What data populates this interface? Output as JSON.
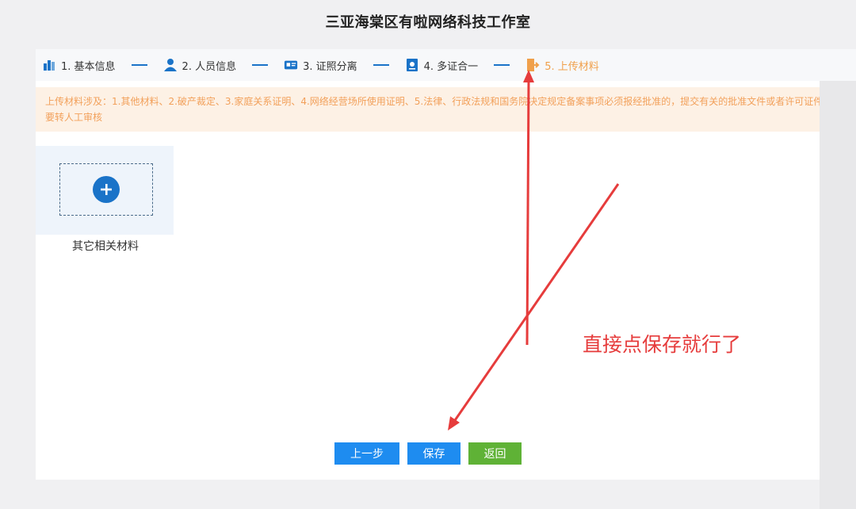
{
  "header": {
    "title": "三亚海棠区有啦网络科技工作室"
  },
  "steps": [
    {
      "label": "1. 基本信息",
      "icon": "building-icon",
      "active": false
    },
    {
      "label": "2. 人员信息",
      "icon": "user-icon",
      "active": false
    },
    {
      "label": "3. 证照分离",
      "icon": "id-card-icon",
      "active": false
    },
    {
      "label": "4. 多证合一",
      "icon": "certificate-icon",
      "active": false
    },
    {
      "label": "5. 上传材料",
      "icon": "upload-door-icon",
      "active": true
    }
  ],
  "notice": {
    "text": "上传材料涉及：1.其他材料、2.破产裁定、3.家庭关系证明、4.网络经营场所使用证明、5.法律、行政法规和国务院决定规定备案事项必须报经批准的，提交有关的批准文件或者许可证件，需要转人工审核"
  },
  "upload": {
    "label": "其它相关材料"
  },
  "buttons": {
    "prev": "上一步",
    "save": "保存",
    "back": "返回"
  },
  "annotation": {
    "text": "直接点保存就行了"
  },
  "colors": {
    "primary": "#1e8cf0",
    "success": "#5fb236",
    "active_step": "#f0a04b",
    "notice_bg": "#fdf1e5",
    "notice_text": "#f2a05a",
    "annotation": "#e63c3c"
  }
}
